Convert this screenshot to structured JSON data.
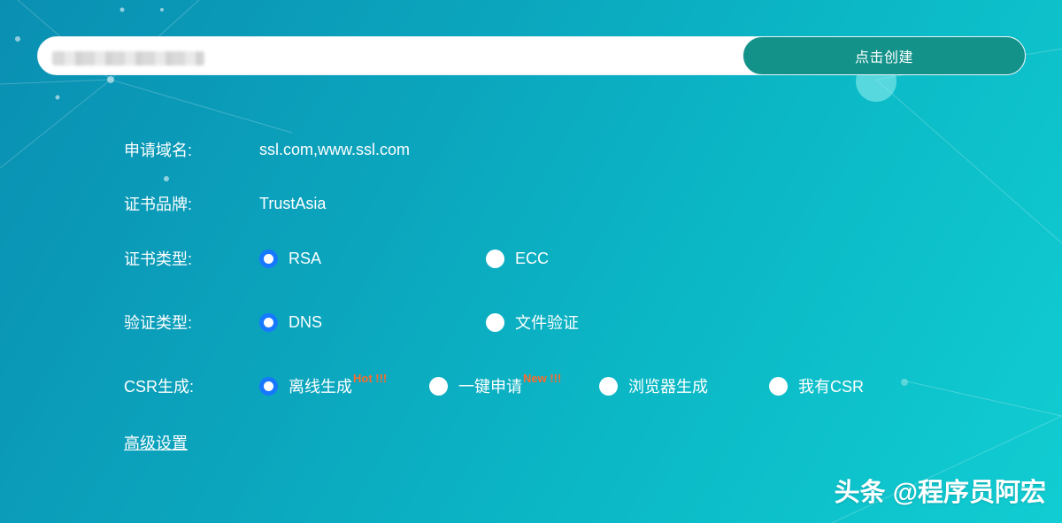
{
  "create_bar": {
    "input_value": "",
    "button_label": "点击创建"
  },
  "form": {
    "domain": {
      "label": "申请域名:",
      "value": "ssl.com,www.ssl.com"
    },
    "brand": {
      "label": "证书品牌:",
      "value": "TrustAsia"
    },
    "cert_type": {
      "label": "证书类型:",
      "options": [
        {
          "label": "RSA",
          "checked": true
        },
        {
          "label": "ECC",
          "checked": false
        }
      ]
    },
    "verify_type": {
      "label": "验证类型:",
      "options": [
        {
          "label": "DNS",
          "checked": true
        },
        {
          "label": "文件验证",
          "checked": false
        }
      ]
    },
    "csr": {
      "label": "CSR生成:",
      "options": [
        {
          "label": "离线生成",
          "tag": "Hot !!!",
          "checked": true
        },
        {
          "label": "一键申请",
          "tag": "New !!!",
          "checked": false
        },
        {
          "label": "浏览器生成",
          "checked": false
        },
        {
          "label": "我有CSR",
          "checked": false
        }
      ]
    },
    "advanced_link": "高级设置"
  },
  "colors": {
    "button": "#13928a",
    "radio_checked": "#1678ff",
    "tag": "#ff6a2b"
  },
  "watermark": "头条 @程序员阿宏"
}
